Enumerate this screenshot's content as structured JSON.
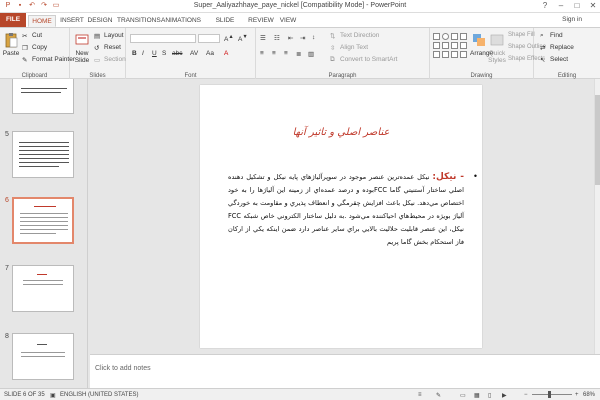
{
  "window": {
    "title": "Super_Aaliyazhhaye_paye_nickel [Compatibility Mode] - PowerPoint",
    "signin": "Sign in",
    "controls": [
      "?",
      "–",
      "□",
      "✕"
    ]
  },
  "tabs": [
    "FILE",
    "HOME",
    "INSERT",
    "DESIGN",
    "TRANSITIONS",
    "ANIMATIONS",
    "SLIDE SHOW",
    "REVIEW",
    "VIEW"
  ],
  "active_tab": "HOME",
  "ribbon": {
    "clipboard": {
      "label": "Clipboard",
      "paste": "Paste",
      "cut": "Cut",
      "copy": "Copy",
      "format_painter": "Format Painter"
    },
    "slides": {
      "label": "Slides",
      "new_slide": "New Slide",
      "layout": "Layout",
      "reset": "Reset",
      "section": "Section"
    },
    "font": {
      "label": "Font"
    },
    "paragraph": {
      "label": "Paragraph",
      "text_direction": "Text Direction",
      "align_text": "Align Text",
      "convert_smartart": "Convert to SmartArt"
    },
    "drawing": {
      "label": "Drawing",
      "arrange": "Arrange",
      "quick_styles": "Quick Styles",
      "shape_fill": "Shape Fill",
      "shape_outline": "Shape Outline",
      "shape_effects": "Shape Effects"
    },
    "editing": {
      "label": "Editing",
      "find": "Find",
      "replace": "Replace",
      "select": "Select"
    }
  },
  "thumbnails": [
    {
      "number": "5",
      "selected": false
    },
    {
      "number": "6",
      "selected": true
    },
    {
      "number": "7",
      "selected": false
    },
    {
      "number": "8",
      "selected": false
    }
  ],
  "slide": {
    "title": "عناصر اصلي و تاثير آنها",
    "lead": "- نيکل:",
    "body": "نيکل عمده‌ترين عنصر موجود در سوپرآلياژهاي پايه نيکل و تشکيل دهنده اصلي ساختار آستنيتي گاما FCCبوده و درصد عمده‌اي از زمينه اين آلياژها را به خود اختصاص مي‌دهد. نيکل باعث افزايش چقرمگي و انعطاف پذيري و مقاومت به خوردگي آلياژ بويژه در محيط‌هاي احيا‌کننده مي‌شود .به دليل ساختار الکتروني خاص شبکه FCC نيکل، اين عنصر قابليت حلاليت بالايي براي ساير عناصر دارد ضمن اينکه يکي از ارکان فاز استحکام بخش گاما پريم"
  },
  "notes_placeholder": "Click to add notes",
  "status": {
    "slide_counter": "SLIDE 6 OF 35",
    "language": "ENGLISH (UNITED STATES)",
    "zoom": "68%"
  }
}
